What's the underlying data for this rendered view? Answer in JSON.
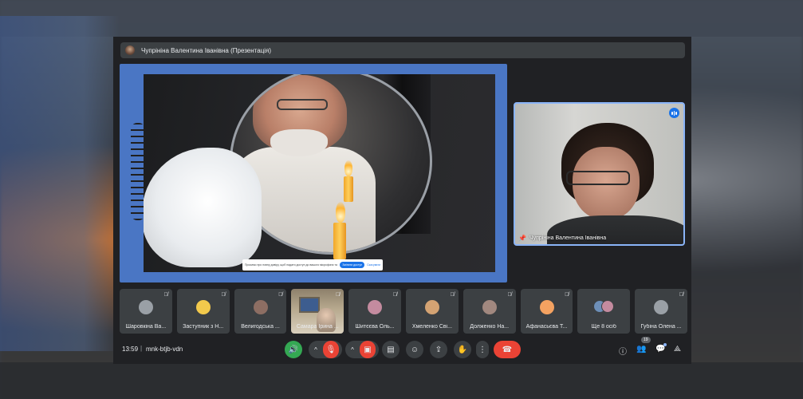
{
  "meeting": {
    "presenter_title": "Чупрініна Валентина Іванівна (Презентація)",
    "time": "13:59",
    "separator": "|",
    "code": "mnk-btjb-vdn",
    "participant_count": "19"
  },
  "presentation": {
    "notice_text": "Просимо про повну довіру, щоб надати доступ до вашого мікрофона та камери",
    "notice_button": "Змінити доступ",
    "notice_link": "Скасувати"
  },
  "spotlight": {
    "name": "Чупрініна Валентина Іванівна"
  },
  "participants": [
    {
      "name": "Шаровкіна Ва...",
      "avatar_color": "#9aa0a6"
    },
    {
      "name": "Заступник з Н...",
      "avatar_color": "#f2c94c"
    },
    {
      "name": "Велигодська ...",
      "avatar_color": "#8d6e63"
    },
    {
      "name": "Самара Ірина ...",
      "avatar_color": "#b7a98e"
    },
    {
      "name": "Шитєєва Оль...",
      "avatar_color": "#c48b9f"
    },
    {
      "name": "Хмеленко Сві...",
      "avatar_color": "#d4a373"
    },
    {
      "name": "Долженко На...",
      "avatar_color": "#a1887f"
    },
    {
      "name": "Афанасьєва Т...",
      "avatar_color": "#f4a261"
    },
    {
      "name": "Ще 8 осіб",
      "avatar_color": "#6d8fb8"
    },
    {
      "name": "Губіна Олена ...",
      "avatar_color": "#9aa0a6"
    }
  ],
  "icons": {
    "mute": "mic-off-icon",
    "pin": "pin-icon",
    "speaking": "speaking-icon",
    "captions": "captions-icon",
    "emoji": "emoji-icon",
    "present": "present-icon",
    "hand": "raise-hand-icon",
    "more": "more-vert-icon",
    "leave": "call-end-icon",
    "info": "info-icon",
    "people": "people-icon",
    "chat": "chat-icon",
    "activities": "activities-icon"
  },
  "colors": {
    "stage_blue": "#4a76c4",
    "accent_blue": "#8ab4f8",
    "danger_red": "#ea4335",
    "speaker_green": "#34a853"
  }
}
